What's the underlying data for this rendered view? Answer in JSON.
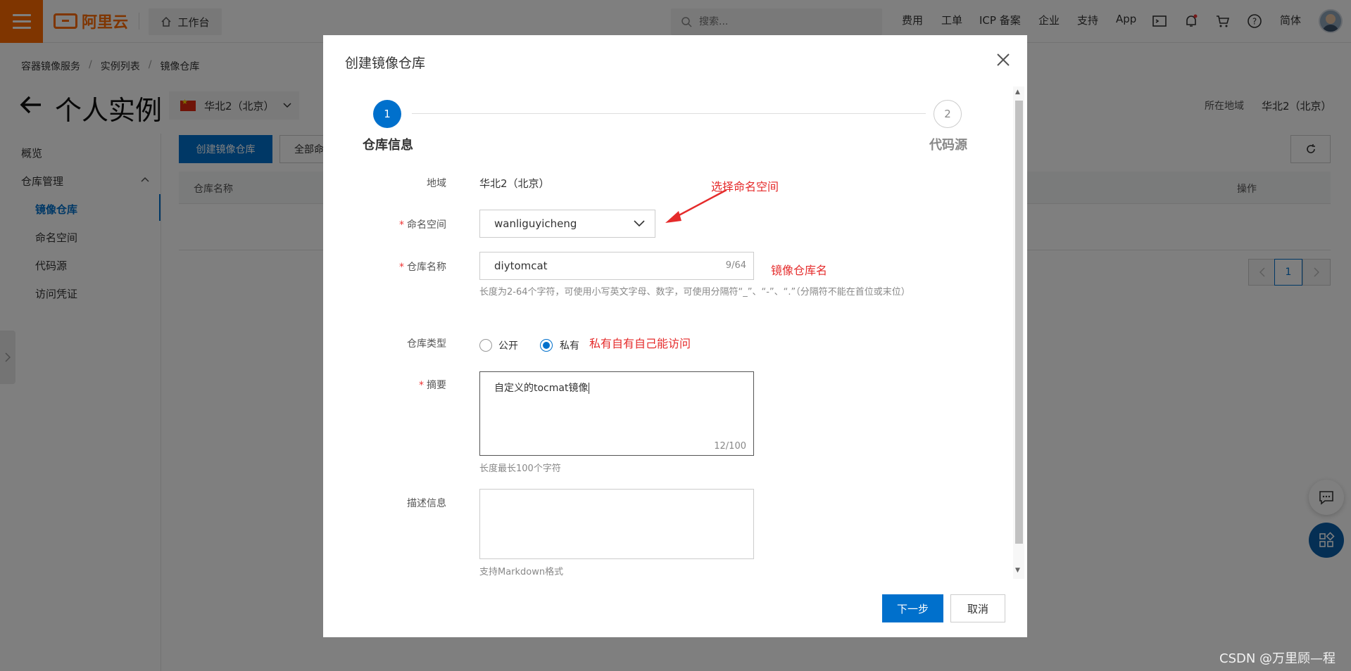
{
  "topbar": {
    "logo_text": "阿里云",
    "workbench_label": "工作台",
    "search_placeholder": "搜索...",
    "nav_links": [
      "费用",
      "工单",
      "ICP 备案",
      "企业",
      "支持",
      "App"
    ],
    "lang_label": "简体",
    "brand_color": "#ff6a00"
  },
  "breadcrumb": [
    "容器镜像服务",
    "实例列表",
    "镜像仓库"
  ],
  "page": {
    "title": "个人实例",
    "region_select": "华北2（北京）",
    "region_right_label": "所在地域",
    "region_right_value": "华北2（北京）"
  },
  "sidebar": {
    "overview": "概览",
    "repo_management": "仓库管理",
    "sub_items": [
      "镜像仓库",
      "命名空间",
      "代码源",
      "访问凭证"
    ]
  },
  "content": {
    "create_repo_button": "创建镜像仓库",
    "all_ns_button": "全部命",
    "table_col_name": "仓库名称",
    "table_col_op": "操作",
    "pagination_current": "1"
  },
  "dialog": {
    "title": "创建镜像仓库",
    "steps": [
      {
        "num": "1",
        "label": "仓库信息"
      },
      {
        "num": "2",
        "label": "代码源"
      }
    ],
    "fields": {
      "region_label": "地域",
      "region_value": "华北2（北京）",
      "namespace_label": "命名空间",
      "namespace_value": "wanliguyicheng",
      "repo_name_label": "仓库名称",
      "repo_name_value": "diytomcat",
      "repo_name_count": "9/64",
      "repo_name_hint": "长度为2-64个字符，可使用小写英文字母、数字，可使用分隔符“_”、“-”、“.”（分隔符不能在首位或末位）",
      "repo_type_label": "仓库类型",
      "repo_type_public": "公开",
      "repo_type_private": "私有",
      "summary_label": "摘要",
      "summary_value": "自定义的tocmat镜像",
      "summary_count": "12/100",
      "summary_hint": "长度最长100个字符",
      "desc_label": "描述信息",
      "desc_hint": "支持Markdown格式"
    },
    "next_button": "下一步",
    "cancel_button": "取消",
    "accent_color": "#0070cc"
  },
  "annotations": {
    "select_namespace": "选择命名空间",
    "repo_name": "镜像仓库名",
    "private_note": "私有自有自己能访问"
  },
  "watermark": "CSDN @万里顾—程"
}
